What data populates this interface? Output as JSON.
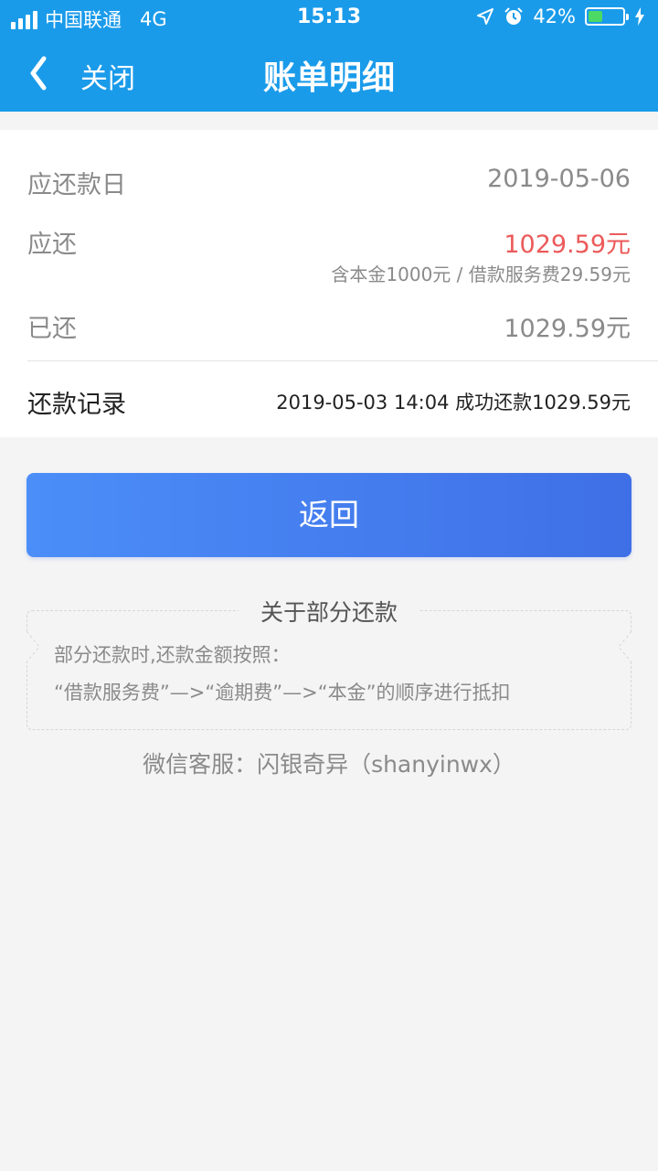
{
  "status_bar": {
    "carrier": "中国联通",
    "network": "4G",
    "time": "15:13",
    "battery_percent": "42%",
    "battery_level": 0.42,
    "icons": [
      "signal-icon",
      "location-arrow-icon",
      "alarm-icon",
      "battery-icon",
      "charging-bolt-icon"
    ]
  },
  "nav": {
    "close_label": "关闭",
    "title": "账单明细",
    "back_icon": "chevron-left-icon"
  },
  "bill": {
    "due_date_label": "应还款日",
    "due_date_value": "2019-05-06",
    "payable_label": "应还",
    "payable_value": "1029.59元",
    "payable_breakdown": "含本金1000元 / 借款服务费29.59元",
    "paid_label": "已还",
    "paid_value": "1029.59元",
    "record_label": "还款记录",
    "record_value": "2019-05-03 14:04 成功还款1029.59元"
  },
  "actions": {
    "return_label": "返回"
  },
  "notice": {
    "title": "关于部分还款",
    "line1": "部分还款时,还款金额按照：",
    "line2": "“借款服务费”—>“逾期费”—>“本金”的顺序进行抵扣"
  },
  "footer": {
    "service": "微信客服：闪银奇异（shanyinwx）"
  },
  "colors": {
    "header_blue": "#1a9bea",
    "amount_red": "#ec5a5a",
    "button_gradient_start": "#4b8ef8",
    "button_gradient_end": "#3f6fe6"
  }
}
